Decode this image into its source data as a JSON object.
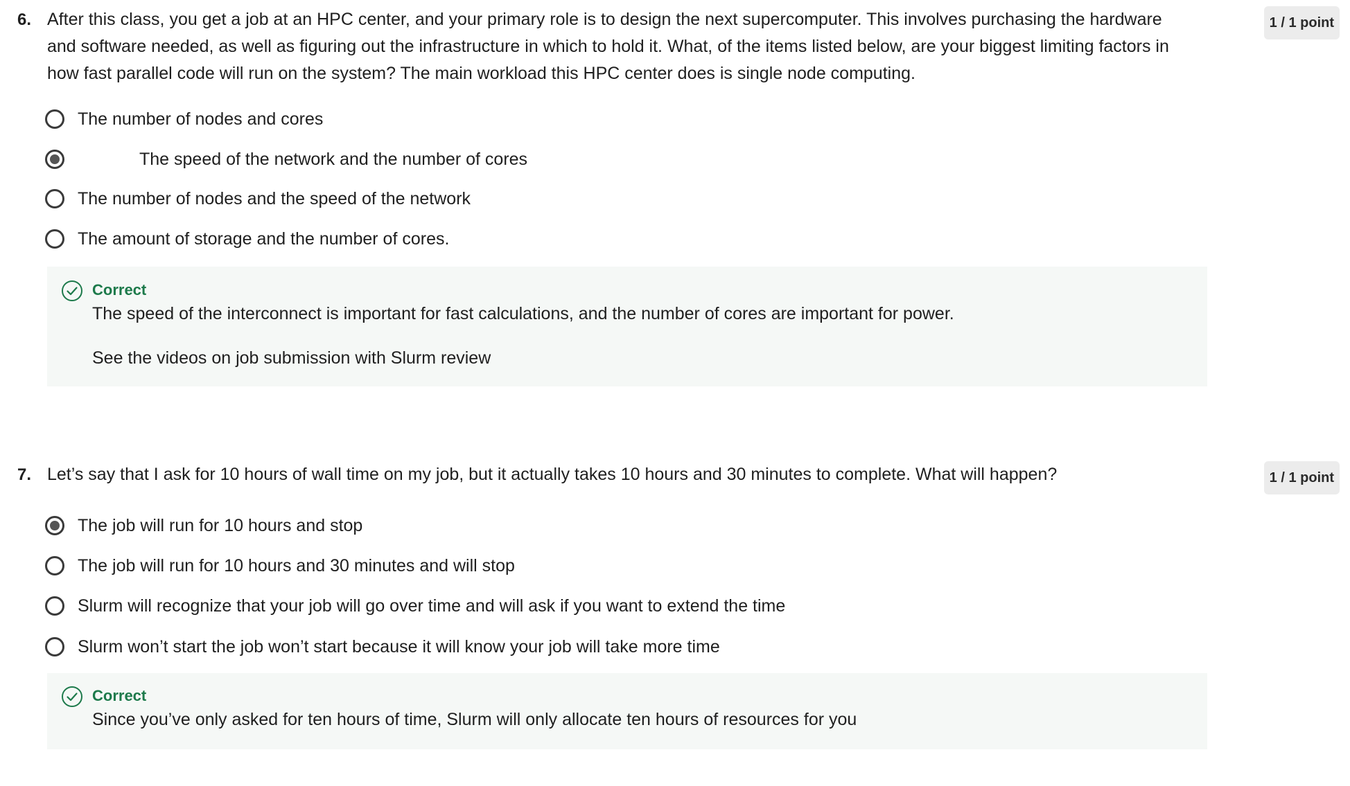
{
  "questions": [
    {
      "number": "6.",
      "text": "After this class, you get a job at an HPC center, and your primary role is to design the next supercomputer. This involves purchasing the hardware and software needed, as well as figuring out the infrastructure in which to hold it. What, of the items listed below, are your biggest limiting factors in how fast parallel code will run on the system?  The main workload this HPC center does is single node computing.",
      "points": "1 / 1 point",
      "options": [
        {
          "label": "The number of nodes and cores",
          "selected": false
        },
        {
          "label": "The speed of the network and the number of cores",
          "selected": true
        },
        {
          "label": "The number of nodes and the speed of the network",
          "selected": false
        },
        {
          "label": "The amount of storage and the number of cores.",
          "selected": false
        }
      ],
      "feedback": {
        "status": "Correct",
        "lines": [
          "The speed of the interconnect is important for fast calculations, and the number of cores are important for power.",
          "See the videos on job submission with Slurm review"
        ]
      }
    },
    {
      "number": "7.",
      "text": "Let’s say that I ask for 10 hours of wall time on my job, but it actually takes 10 hours and 30 minutes to complete.  What will happen?",
      "points": "1 / 1 point",
      "options": [
        {
          "label": "The job will run for 10 hours and stop",
          "selected": true
        },
        {
          "label": "The job will run for 10 hours and 30 minutes and will stop",
          "selected": false
        },
        {
          "label": "Slurm will recognize that your job will go over time and will ask if you want to extend the time",
          "selected": false
        },
        {
          "label": "Slurm won’t start the job won’t start because it will know your job will take more time",
          "selected": false
        }
      ],
      "feedback": {
        "status": "Correct",
        "lines": [
          "Since you’ve only asked for ten hours of time, Slurm will only allocate ten hours of resources for you"
        ]
      }
    }
  ],
  "colors": {
    "correct_green": "#1d7a4b",
    "feedback_bg": "#f5f8f6",
    "points_badge_bg": "#ececec"
  },
  "icons": {
    "radio": "radio-button-icon",
    "correct": "check-circle-icon"
  }
}
